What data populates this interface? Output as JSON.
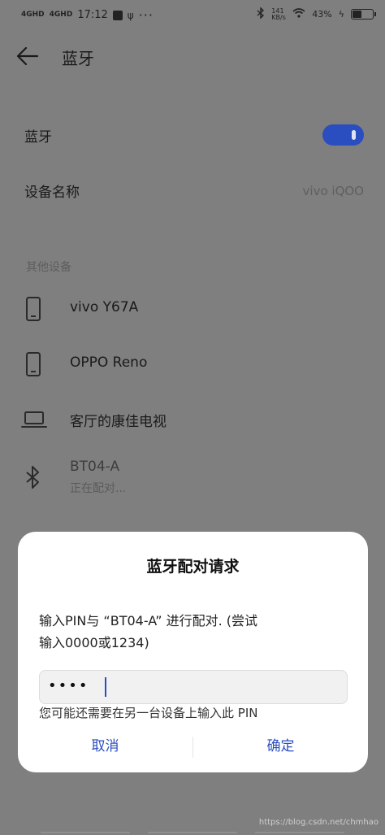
{
  "status_bar": {
    "signal1": "4GHD",
    "signal2": "4GHD",
    "time": "17:12",
    "dots": "···",
    "net_speed": "141\nKB/s",
    "battery_pct": "43%"
  },
  "header": {
    "title": "蓝牙"
  },
  "bluetooth_row": {
    "label": "蓝牙",
    "enabled": true
  },
  "device_name_row": {
    "label": "设备名称",
    "value": "vivo iQOO"
  },
  "section": {
    "title": "其他设备"
  },
  "devices": [
    {
      "name": "vivo Y67A",
      "icon": "phone-icon"
    },
    {
      "name": "OPPO Reno",
      "icon": "phone-icon"
    },
    {
      "name": "客厅的康佳电视",
      "icon": "laptop-icon"
    },
    {
      "name": "BT04-A",
      "status": "正在配对...",
      "icon": "bluetooth-icon"
    }
  ],
  "dialog": {
    "title": "蓝牙配对请求",
    "message_line1": "输入PIN与 “BT04-A” 进行配对. (尝试",
    "message_line2": "输入0000或1234)",
    "pin_value": "••••",
    "hint": "您可能还需要在另一台设备上输入此 PIN",
    "cancel_label": "取消",
    "confirm_label": "确定"
  },
  "watermark": "https://blog.csdn.net/chmhao",
  "colors": {
    "accent": "#2a4dbf",
    "scrim": "#7f7f7f"
  }
}
